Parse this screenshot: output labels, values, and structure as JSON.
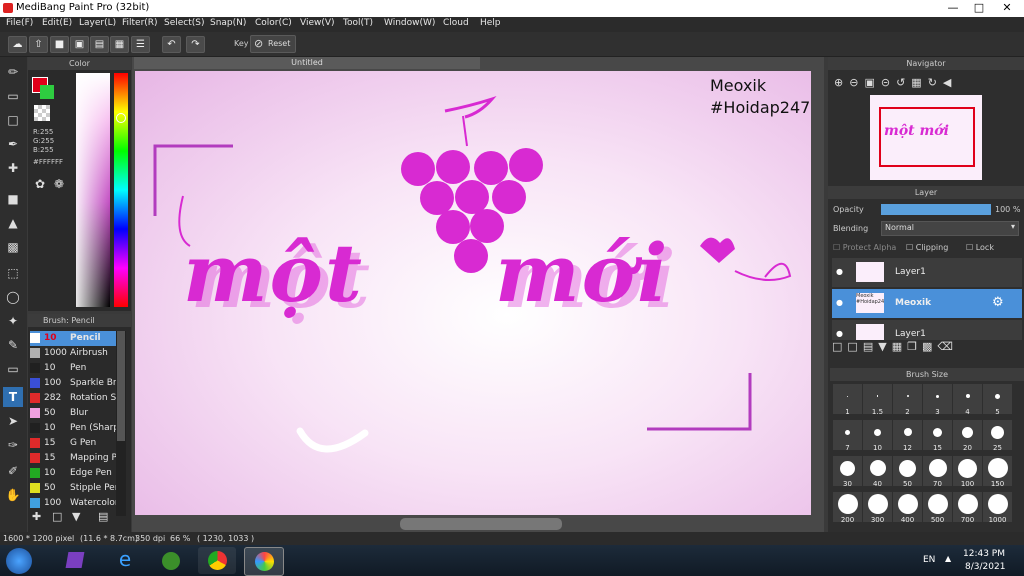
{
  "window": {
    "title": "MediBang Paint Pro (32bit)"
  },
  "menu": [
    "File(F)",
    "Edit(E)",
    "Layer(L)",
    "Filter(R)",
    "Select(S)",
    "Snap(N)",
    "Color(C)",
    "View(V)",
    "Tool(T)",
    "Window(W)",
    "Cloud",
    "Help"
  ],
  "toolbar": {
    "key_label": "Key",
    "reset_label": "Reset"
  },
  "color_panel": {
    "title": "Color",
    "rgb": [
      "R:255",
      "G:255",
      "B:255"
    ],
    "hex": "#FFFFFF",
    "fg": "#e0001a",
    "bg": "#2ecc40"
  },
  "brush_panel": {
    "title": "Brush: Pencil",
    "items": [
      {
        "size": "10",
        "name": "Pencil",
        "color": "#ffffff",
        "selected": true
      },
      {
        "size": "1000",
        "name": "Airbrush",
        "color": "#b0b0b0"
      },
      {
        "size": "10",
        "name": "Pen",
        "color": "#202020"
      },
      {
        "size": "100",
        "name": "Sparkle Bru",
        "color": "#3a4fd6"
      },
      {
        "size": "282",
        "name": "Rotation Sy",
        "color": "#e02a2a"
      },
      {
        "size": "50",
        "name": "Blur",
        "color": "#f0a0e0"
      },
      {
        "size": "10",
        "name": "Pen (Sharp",
        "color": "#202020"
      },
      {
        "size": "15",
        "name": "G Pen",
        "color": "#e02a2a"
      },
      {
        "size": "15",
        "name": "Mapping Pe",
        "color": "#e02a2a"
      },
      {
        "size": "10",
        "name": "Edge Pen",
        "color": "#22aa22"
      },
      {
        "size": "50",
        "name": "Stipple Pen",
        "color": "#e0e020"
      },
      {
        "size": "100",
        "name": "Watercolor",
        "color": "#40a0e0"
      }
    ]
  },
  "canvas": {
    "tab": "Untitled",
    "watermark_line1": "Meoxik",
    "watermark_line2": "#Hoidap247",
    "word1": "một",
    "word2": "mới"
  },
  "navigator": {
    "title": "Navigator",
    "thumb_text": "một mới"
  },
  "layer_panel": {
    "title": "Layer",
    "opacity_label": "Opacity",
    "opacity_value": "100 %",
    "opacity_fraction": 1.0,
    "blending_label": "Blending",
    "blending_value": "Normal",
    "protect_alpha": "Protect Alpha",
    "clipping": "Clipping",
    "lock": "Lock",
    "layers": [
      {
        "name": "Layer1",
        "thumb_text": "",
        "selected": false
      },
      {
        "name": "Meoxik",
        "thumb_text": "Meoxik #Hoidap247",
        "selected": true
      },
      {
        "name": "Layer1",
        "thumb_text": "",
        "selected": false
      }
    ]
  },
  "brush_size": {
    "title": "Brush Size",
    "sizes": [
      "1",
      "1.5",
      "2",
      "3",
      "4",
      "5",
      "7",
      "10",
      "12",
      "15",
      "20",
      "25",
      "30",
      "40",
      "50",
      "70",
      "100",
      "150",
      "200",
      "300",
      "400",
      "500",
      "700",
      "1000"
    ]
  },
  "status": {
    "size": "1600 * 1200 pixel",
    "cm": "(11.6 * 8.7cm)",
    "dpi": "350 dpi",
    "zoom": "66 %",
    "coords": "( 1230, 1033 )"
  },
  "taskbar": {
    "lang": "EN",
    "time": "12:43 PM",
    "date": "8/3/2021"
  },
  "colors": {
    "accent": "#4a90d9",
    "pink": "#d82ad2",
    "panel": "#2a2a2a"
  }
}
